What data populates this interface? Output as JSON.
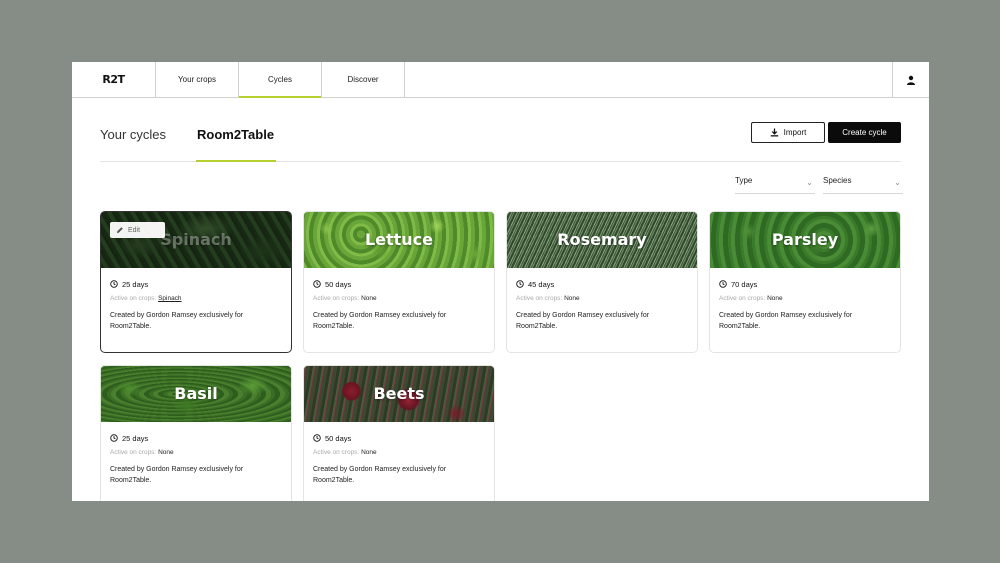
{
  "nav": {
    "logo": "R2T",
    "tabs": [
      {
        "label": "Your crops",
        "active": false
      },
      {
        "label": "Cycles",
        "active": true
      },
      {
        "label": "Discover",
        "active": false
      }
    ],
    "user_icon": "user-icon"
  },
  "page_tabs": [
    {
      "label": "Your cycles",
      "active": false
    },
    {
      "label": "Room2Table",
      "active": true
    }
  ],
  "actions": {
    "import_label": "Import",
    "import_icon": "download-icon",
    "create_label": "Create cycle"
  },
  "filters": {
    "type_label": "Type",
    "species_label": "Species"
  },
  "accent_color": "#b6cf2f",
  "cards": [
    {
      "title": "Spinach",
      "days": "25 days",
      "active_label": "Active on crops:",
      "active_value": "Spinach",
      "description": "Created by Gordon Ramsey exclusively for Room2Table.",
      "selected": true,
      "edit_label": "Edit"
    },
    {
      "title": "Lettuce",
      "days": "50 days",
      "active_label": "Active on crops:",
      "active_value": "None",
      "description": "Created by Gordon Ramsey exclusively for Room2Table."
    },
    {
      "title": "Rosemary",
      "days": "45 days",
      "active_label": "Active on crops:",
      "active_value": "None",
      "description": "Created by Gordon Ramsey exclusively for Room2Table."
    },
    {
      "title": "Parsley",
      "days": "70 days",
      "active_label": "Active on crops:",
      "active_value": "None",
      "description": "Created by Gordon Ramsey exclusively for Room2Table."
    },
    {
      "title": "Basil",
      "days": "25 days",
      "active_label": "Active on crops:",
      "active_value": "None",
      "description": "Created by Gordon Ramsey exclusively for Room2Table."
    },
    {
      "title": "Beets",
      "days": "50 days",
      "active_label": "Active on crops:",
      "active_value": "None",
      "description": "Created by Gordon Ramsey exclusively for Room2Table."
    }
  ]
}
